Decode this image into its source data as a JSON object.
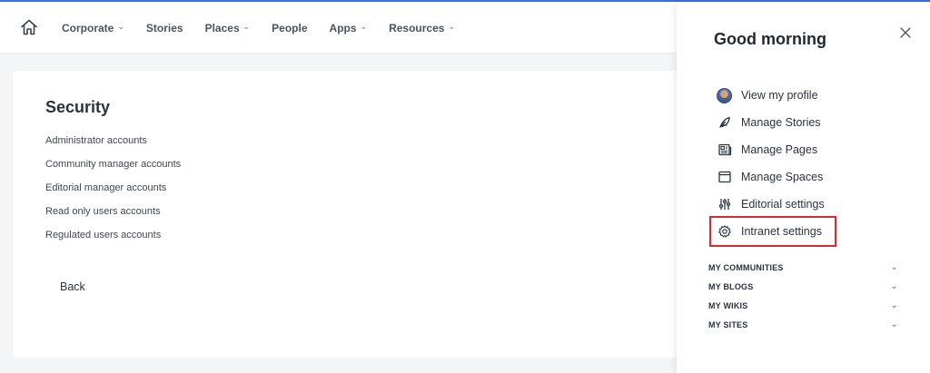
{
  "topnav": {
    "items": [
      {
        "label": "Corporate",
        "dropdown": true
      },
      {
        "label": "Stories",
        "dropdown": false
      },
      {
        "label": "Places",
        "dropdown": true
      },
      {
        "label": "People",
        "dropdown": false
      },
      {
        "label": "Apps",
        "dropdown": true
      },
      {
        "label": "Resources",
        "dropdown": true
      }
    ],
    "chevron": "⌄"
  },
  "main": {
    "title": "Security",
    "links": [
      "Administrator accounts",
      "Community manager accounts",
      "Editorial manager accounts",
      "Read only users accounts",
      "Regulated users accounts"
    ],
    "back_label": "Back"
  },
  "panel": {
    "greeting": "Good morning",
    "menu": [
      {
        "label": "View my profile",
        "icon": "avatar-icon"
      },
      {
        "label": "Manage Stories",
        "icon": "feather-icon"
      },
      {
        "label": "Manage Pages",
        "icon": "newspaper-icon"
      },
      {
        "label": "Manage Spaces",
        "icon": "window-icon"
      },
      {
        "label": "Editorial settings",
        "icon": "sliders-icon"
      },
      {
        "label": "Intranet settings",
        "icon": "gear-icon",
        "highlighted": true
      }
    ],
    "sections": [
      "MY COMMUNITIES",
      "MY BLOGS",
      "MY WIKIS",
      "MY SITES"
    ]
  },
  "colors": {
    "accent_line": "#3a6fd8",
    "highlight_outline": "#d92b2b"
  }
}
